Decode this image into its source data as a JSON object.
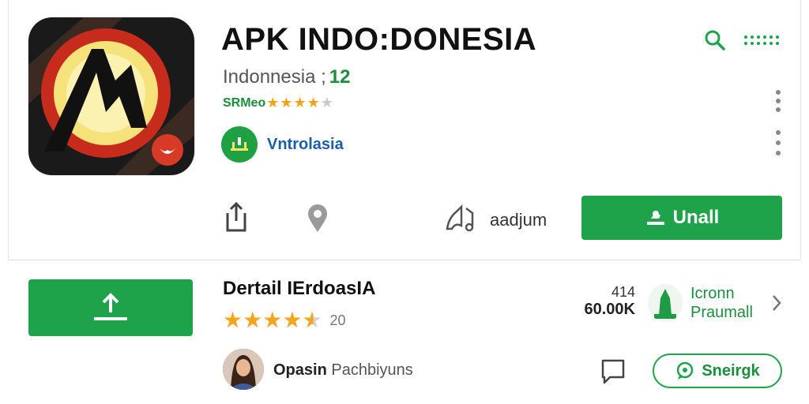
{
  "app": {
    "title": "APK INDO:DONESIA",
    "subtitle": "Indonnesia ;",
    "subtitle_num": "12",
    "rating_label": "SRMeo",
    "developer": "Vntrolasia"
  },
  "actions": {
    "audio_label": "aadjum",
    "install_label": "Unall"
  },
  "detail": {
    "title": "Dertail IErdoasIA",
    "review_count": "20",
    "stat_top": "414",
    "stat_bottom": "60.00K",
    "dev_line1": "Icronn",
    "dev_line2": "Praumall"
  },
  "user": {
    "name_bold": "Opasin",
    "name_rest": "Pachbiyuns"
  },
  "buttons": {
    "share_pill_label": "Sneirgk"
  },
  "colors": {
    "primary_green": "#1fa34a",
    "star": "#f4a51c",
    "developer_link": "#1b5ea8"
  },
  "icons": [
    "search-icon",
    "menu-dots-icon",
    "kebab-icon",
    "share-icon",
    "location-pin-icon",
    "audio-icon",
    "download-icon",
    "upload-icon",
    "chevron-right-icon",
    "comment-icon",
    "chat-icon"
  ]
}
